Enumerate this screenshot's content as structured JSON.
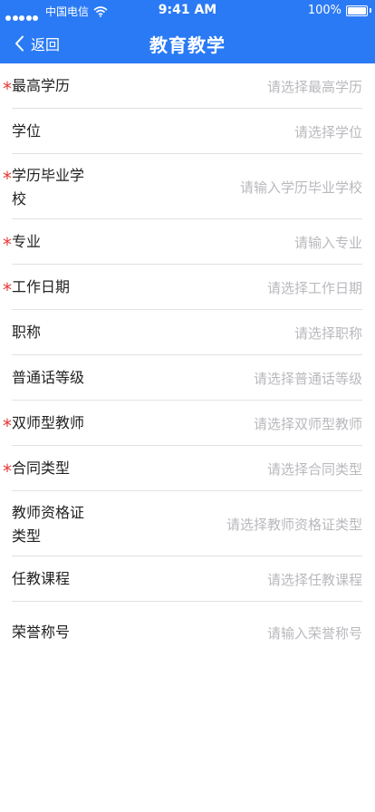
{
  "status_bar": {
    "carrier": "中国电信",
    "time": "9:41 AM",
    "battery": "100%"
  },
  "nav": {
    "back_label": "返回",
    "title": "教育教学"
  },
  "colors": {
    "header": "#2b7af5",
    "required_star": "#e53935",
    "placeholder": "#b9b9be",
    "divider": "#e1e1e1"
  },
  "fields": [
    {
      "required": true,
      "label": "最高学历",
      "placeholder": "请选择最高学历"
    },
    {
      "required": false,
      "label": "学位",
      "placeholder": "请选择学位"
    },
    {
      "required": true,
      "label": "学历毕业学",
      "label_line2": "校",
      "placeholder": "请输入学历毕业学校"
    },
    {
      "required": true,
      "label": "专业",
      "placeholder": "请输入专业"
    },
    {
      "required": true,
      "label": "工作日期",
      "placeholder": "请选择工作日期"
    },
    {
      "required": false,
      "label": "职称",
      "placeholder": "请选择职称"
    },
    {
      "required": false,
      "label": "普通话等级",
      "placeholder": "请选择普通话等级"
    },
    {
      "required": true,
      "label": "双师型教师",
      "placeholder": "请选择双师型教师"
    },
    {
      "required": true,
      "label": "合同类型",
      "placeholder": "请选择合同类型"
    },
    {
      "required": false,
      "label": "教师资格证",
      "label_line2": "类型",
      "placeholder": "请选择教师资格证类型"
    },
    {
      "required": false,
      "label": "任教课程",
      "placeholder": "请选择任教课程"
    },
    {
      "required": false,
      "label": "荣誉称号",
      "placeholder": "请输入荣誉称号"
    }
  ]
}
